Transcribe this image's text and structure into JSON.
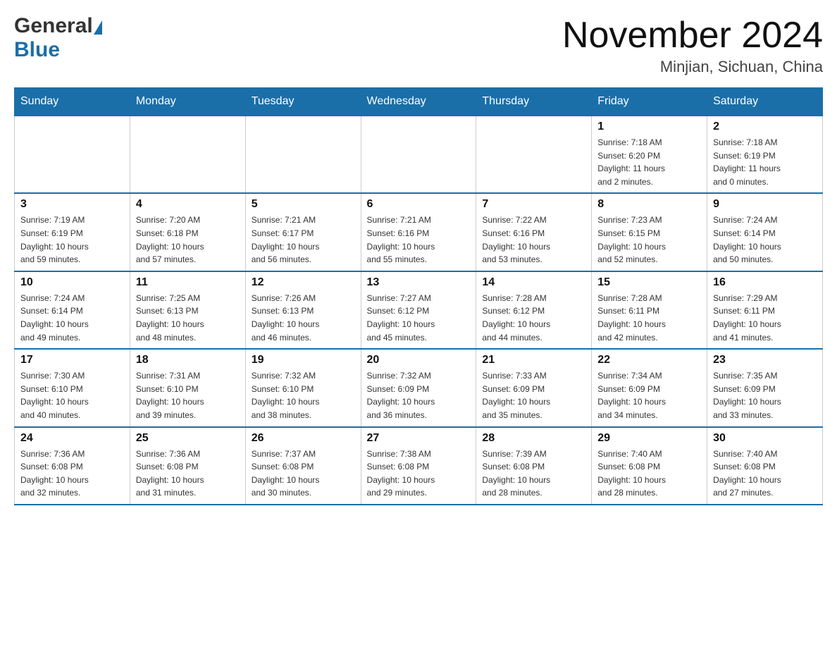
{
  "header": {
    "logo_general": "General",
    "logo_blue": "Blue",
    "month_title": "November 2024",
    "location": "Minjian, Sichuan, China"
  },
  "weekdays": [
    "Sunday",
    "Monday",
    "Tuesday",
    "Wednesday",
    "Thursday",
    "Friday",
    "Saturday"
  ],
  "weeks": [
    [
      {
        "day": "",
        "info": ""
      },
      {
        "day": "",
        "info": ""
      },
      {
        "day": "",
        "info": ""
      },
      {
        "day": "",
        "info": ""
      },
      {
        "day": "",
        "info": ""
      },
      {
        "day": "1",
        "info": "Sunrise: 7:18 AM\nSunset: 6:20 PM\nDaylight: 11 hours\nand 2 minutes."
      },
      {
        "day": "2",
        "info": "Sunrise: 7:18 AM\nSunset: 6:19 PM\nDaylight: 11 hours\nand 0 minutes."
      }
    ],
    [
      {
        "day": "3",
        "info": "Sunrise: 7:19 AM\nSunset: 6:19 PM\nDaylight: 10 hours\nand 59 minutes."
      },
      {
        "day": "4",
        "info": "Sunrise: 7:20 AM\nSunset: 6:18 PM\nDaylight: 10 hours\nand 57 minutes."
      },
      {
        "day": "5",
        "info": "Sunrise: 7:21 AM\nSunset: 6:17 PM\nDaylight: 10 hours\nand 56 minutes."
      },
      {
        "day": "6",
        "info": "Sunrise: 7:21 AM\nSunset: 6:16 PM\nDaylight: 10 hours\nand 55 minutes."
      },
      {
        "day": "7",
        "info": "Sunrise: 7:22 AM\nSunset: 6:16 PM\nDaylight: 10 hours\nand 53 minutes."
      },
      {
        "day": "8",
        "info": "Sunrise: 7:23 AM\nSunset: 6:15 PM\nDaylight: 10 hours\nand 52 minutes."
      },
      {
        "day": "9",
        "info": "Sunrise: 7:24 AM\nSunset: 6:14 PM\nDaylight: 10 hours\nand 50 minutes."
      }
    ],
    [
      {
        "day": "10",
        "info": "Sunrise: 7:24 AM\nSunset: 6:14 PM\nDaylight: 10 hours\nand 49 minutes."
      },
      {
        "day": "11",
        "info": "Sunrise: 7:25 AM\nSunset: 6:13 PM\nDaylight: 10 hours\nand 48 minutes."
      },
      {
        "day": "12",
        "info": "Sunrise: 7:26 AM\nSunset: 6:13 PM\nDaylight: 10 hours\nand 46 minutes."
      },
      {
        "day": "13",
        "info": "Sunrise: 7:27 AM\nSunset: 6:12 PM\nDaylight: 10 hours\nand 45 minutes."
      },
      {
        "day": "14",
        "info": "Sunrise: 7:28 AM\nSunset: 6:12 PM\nDaylight: 10 hours\nand 44 minutes."
      },
      {
        "day": "15",
        "info": "Sunrise: 7:28 AM\nSunset: 6:11 PM\nDaylight: 10 hours\nand 42 minutes."
      },
      {
        "day": "16",
        "info": "Sunrise: 7:29 AM\nSunset: 6:11 PM\nDaylight: 10 hours\nand 41 minutes."
      }
    ],
    [
      {
        "day": "17",
        "info": "Sunrise: 7:30 AM\nSunset: 6:10 PM\nDaylight: 10 hours\nand 40 minutes."
      },
      {
        "day": "18",
        "info": "Sunrise: 7:31 AM\nSunset: 6:10 PM\nDaylight: 10 hours\nand 39 minutes."
      },
      {
        "day": "19",
        "info": "Sunrise: 7:32 AM\nSunset: 6:10 PM\nDaylight: 10 hours\nand 38 minutes."
      },
      {
        "day": "20",
        "info": "Sunrise: 7:32 AM\nSunset: 6:09 PM\nDaylight: 10 hours\nand 36 minutes."
      },
      {
        "day": "21",
        "info": "Sunrise: 7:33 AM\nSunset: 6:09 PM\nDaylight: 10 hours\nand 35 minutes."
      },
      {
        "day": "22",
        "info": "Sunrise: 7:34 AM\nSunset: 6:09 PM\nDaylight: 10 hours\nand 34 minutes."
      },
      {
        "day": "23",
        "info": "Sunrise: 7:35 AM\nSunset: 6:09 PM\nDaylight: 10 hours\nand 33 minutes."
      }
    ],
    [
      {
        "day": "24",
        "info": "Sunrise: 7:36 AM\nSunset: 6:08 PM\nDaylight: 10 hours\nand 32 minutes."
      },
      {
        "day": "25",
        "info": "Sunrise: 7:36 AM\nSunset: 6:08 PM\nDaylight: 10 hours\nand 31 minutes."
      },
      {
        "day": "26",
        "info": "Sunrise: 7:37 AM\nSunset: 6:08 PM\nDaylight: 10 hours\nand 30 minutes."
      },
      {
        "day": "27",
        "info": "Sunrise: 7:38 AM\nSunset: 6:08 PM\nDaylight: 10 hours\nand 29 minutes."
      },
      {
        "day": "28",
        "info": "Sunrise: 7:39 AM\nSunset: 6:08 PM\nDaylight: 10 hours\nand 28 minutes."
      },
      {
        "day": "29",
        "info": "Sunrise: 7:40 AM\nSunset: 6:08 PM\nDaylight: 10 hours\nand 28 minutes."
      },
      {
        "day": "30",
        "info": "Sunrise: 7:40 AM\nSunset: 6:08 PM\nDaylight: 10 hours\nand 27 minutes."
      }
    ]
  ]
}
